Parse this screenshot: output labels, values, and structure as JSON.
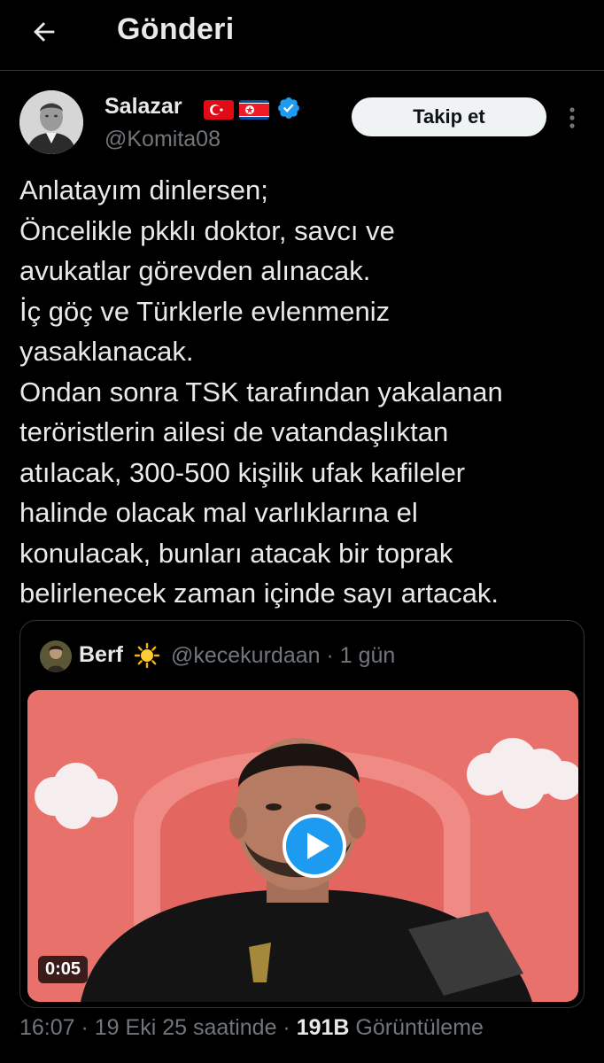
{
  "header": {
    "title": "Gönderi",
    "back_icon": "back-arrow-icon"
  },
  "author": {
    "name": "Salazar",
    "handle": "@Komita08",
    "flags": [
      "turkey-flag-icon",
      "north-korea-flag-icon"
    ],
    "verified_icon": "verified-badge-icon",
    "verified_color": "#1d9bf0"
  },
  "follow_button": {
    "label": "Takip et"
  },
  "more_icon": "more-vertical-icon",
  "post": {
    "lines": [
      "Anlatayım dinlersen;",
      "Öncelikle pkklı doktor, savcı ve",
      "avukatlar görevden alınacak.",
      "İç göç ve Türklerle evlenmeniz",
      "yasaklanacak.",
      "Ondan sonra TSK tarafından yakalanan",
      "teröristlerin ailesi de vatandaşlıktan",
      "atılacak, 300-500 kişilik ufak kafileler",
      "halinde olacak mal varlıklarına el",
      "konulacak, bunları atacak bir toprak",
      "belirlenecek zaman içinde sayı artacak."
    ]
  },
  "quote": {
    "name": "Berf",
    "name_icon": "sun-emoji-icon",
    "meta": "@kecekurdaan · 1 gün",
    "video": {
      "duration": "0:05",
      "play_icon": "play-icon",
      "background_color": "#e8716c"
    }
  },
  "footer": {
    "time": "16:07 · 19 Eki 25 saatinde · ",
    "views_count": "191B",
    "views_label": " Görüntüleme"
  },
  "colors": {
    "background": "#000000",
    "text_primary": "#e7e9ea",
    "text_secondary": "#71767b",
    "border": "#2f3336",
    "accent": "#1d9bf0"
  }
}
